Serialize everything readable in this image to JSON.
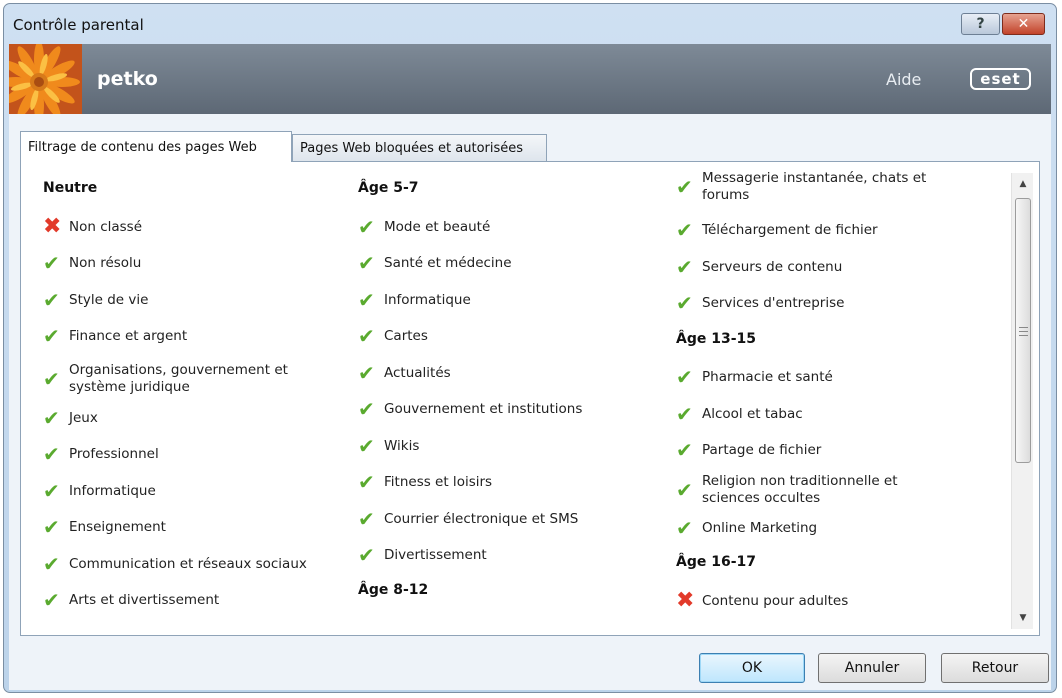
{
  "window": {
    "title": "Contrôle parental",
    "help_label": "?",
    "close_label": "✕"
  },
  "header": {
    "user": "petko",
    "help_link": "Aide",
    "logo_text": "eset"
  },
  "tabs": [
    {
      "label": "Filtrage de contenu des pages Web",
      "active": true
    },
    {
      "label": "Pages Web bloquées et autorisées",
      "active": false
    }
  ],
  "categories": {
    "columns": [
      [
        {
          "kind": "heading",
          "label": "Neutre"
        },
        {
          "kind": "item",
          "label": "Non classé",
          "allowed": false
        },
        {
          "kind": "item",
          "label": "Non résolu",
          "allowed": true
        },
        {
          "kind": "item",
          "label": "Style de vie",
          "allowed": true
        },
        {
          "kind": "item",
          "label": "Finance et argent",
          "allowed": true
        },
        {
          "kind": "item",
          "label": "Organisations, gouvernement et système juridique",
          "allowed": true
        },
        {
          "kind": "item",
          "label": "Jeux",
          "allowed": true
        },
        {
          "kind": "item",
          "label": "Professionnel",
          "allowed": true
        },
        {
          "kind": "item",
          "label": "Informatique",
          "allowed": true
        },
        {
          "kind": "item",
          "label": "Enseignement",
          "allowed": true
        },
        {
          "kind": "item",
          "label": "Communication et réseaux sociaux",
          "allowed": true
        },
        {
          "kind": "item",
          "label": "Arts et divertissement",
          "allowed": true
        }
      ],
      [
        {
          "kind": "heading",
          "label": "Âge 5-7"
        },
        {
          "kind": "item",
          "label": "Mode et beauté",
          "allowed": true
        },
        {
          "kind": "item",
          "label": "Santé et médecine",
          "allowed": true
        },
        {
          "kind": "item",
          "label": "Informatique",
          "allowed": true
        },
        {
          "kind": "item",
          "label": "Cartes",
          "allowed": true
        },
        {
          "kind": "item",
          "label": "Actualités",
          "allowed": true
        },
        {
          "kind": "item",
          "label": "Gouvernement et institutions",
          "allowed": true
        },
        {
          "kind": "item",
          "label": "Wikis",
          "allowed": true
        },
        {
          "kind": "item",
          "label": "Fitness et loisirs",
          "allowed": true
        },
        {
          "kind": "item",
          "label": "Courrier électronique et SMS",
          "allowed": true
        },
        {
          "kind": "item",
          "label": "Divertissement",
          "allowed": true
        },
        {
          "kind": "heading",
          "label": "Âge 8-12"
        }
      ],
      [
        {
          "kind": "item",
          "label": "Messagerie instantanée, chats et forums",
          "allowed": true
        },
        {
          "kind": "item",
          "label": "Téléchargement de fichier",
          "allowed": true
        },
        {
          "kind": "item",
          "label": "Serveurs de contenu",
          "allowed": true
        },
        {
          "kind": "item",
          "label": "Services d'entreprise",
          "allowed": true
        },
        {
          "kind": "heading",
          "label": "Âge 13-15"
        },
        {
          "kind": "item",
          "label": "Pharmacie et santé",
          "allowed": true
        },
        {
          "kind": "item",
          "label": "Alcool et tabac",
          "allowed": true
        },
        {
          "kind": "item",
          "label": "Partage de fichier",
          "allowed": true
        },
        {
          "kind": "item",
          "label": "Religion non traditionnelle et sciences occultes",
          "allowed": true
        },
        {
          "kind": "item",
          "label": "Online Marketing",
          "allowed": true
        },
        {
          "kind": "heading",
          "label": "Âge 16-17"
        },
        {
          "kind": "item",
          "label": "Contenu pour adultes",
          "allowed": false
        }
      ]
    ]
  },
  "buttons": {
    "ok": "OK",
    "cancel": "Annuler",
    "back": "Retour"
  },
  "colors": {
    "allowed": "#5aaa2f",
    "blocked": "#e23a2a",
    "header_band": "#6c7784"
  }
}
